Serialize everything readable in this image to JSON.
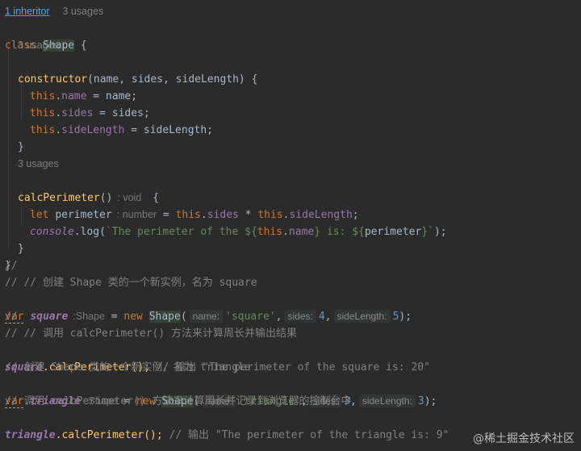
{
  "header": {
    "inheritor_link": "1 inheritor",
    "usages": "3 usages"
  },
  "code": {
    "class_kw": "class",
    "class_name": "Shape",
    "brace_open": " {",
    "ctor_usages": "3 usages",
    "ctor_name": "constructor",
    "ctor_params": "(name, sides, sideLength) {",
    "this_kw": "this",
    "f_name": "name",
    "f_sides": "sides",
    "f_sideLength": "sideLength",
    "assign_name": " = name;",
    "assign_sides": " = sides;",
    "assign_sideLength": " = sideLength;",
    "close_brace": "}",
    "calc_usages": "3 usages",
    "calc_name": "calcPerimeter",
    "calc_parens": "()",
    "calc_type_hint": ": void",
    "calc_brace": "{",
    "let_kw": "let",
    "perimeter_var": "perimeter",
    "perimeter_hint": ": number",
    "eq": " = ",
    "mul": " * ",
    "semi": ";",
    "console": "console",
    "log": ".log(",
    "tpl_text": "`The perimeter of the ${",
    "tpl_mid": "} is: ${",
    "tpl_perimeter": "perimeter",
    "tpl_end": "}`",
    "close_paren": ");",
    "cmt1": "//",
    "cmt2": "// // 创建 Shape 类的一个新实例，名为 square",
    "var_kw": "var",
    "square_var": "square",
    "shape_hint": ":Shape",
    "new_kw": "new",
    "hint_name": "name:",
    "hint_sides": "sides:",
    "hint_sideLength": "sideLength:",
    "str_square": "'square'",
    "num_4": "4",
    "num_5": "5",
    "cmt3": "//",
    "cmt4": "// // 调用 calcPerimeter() 方法来计算周长并输出结果",
    "square_call": ".calcPerimeter();",
    "cmt5": " // 输出 \"The perimeter of the square is: 20\"",
    "cmt6": "// 创建 Shape 类的一个新实例，名为 triangle",
    "triangle_var": "triangle",
    "str_triangle": "'triangle'",
    "num_3a": "3",
    "num_3b": "3",
    "cmt7": "// 调用 calcPerimeter() 方法来计算周长并记录到浏览器的控制台中",
    "triangle_call": ".calcPerimeter();",
    "cmt8": " // 输出 \"The perimeter of the triangle is: 9\"",
    "comma": ",",
    "open_paren": "(",
    "close_p": ");"
  },
  "watermark": "@稀土掘金技术社区"
}
